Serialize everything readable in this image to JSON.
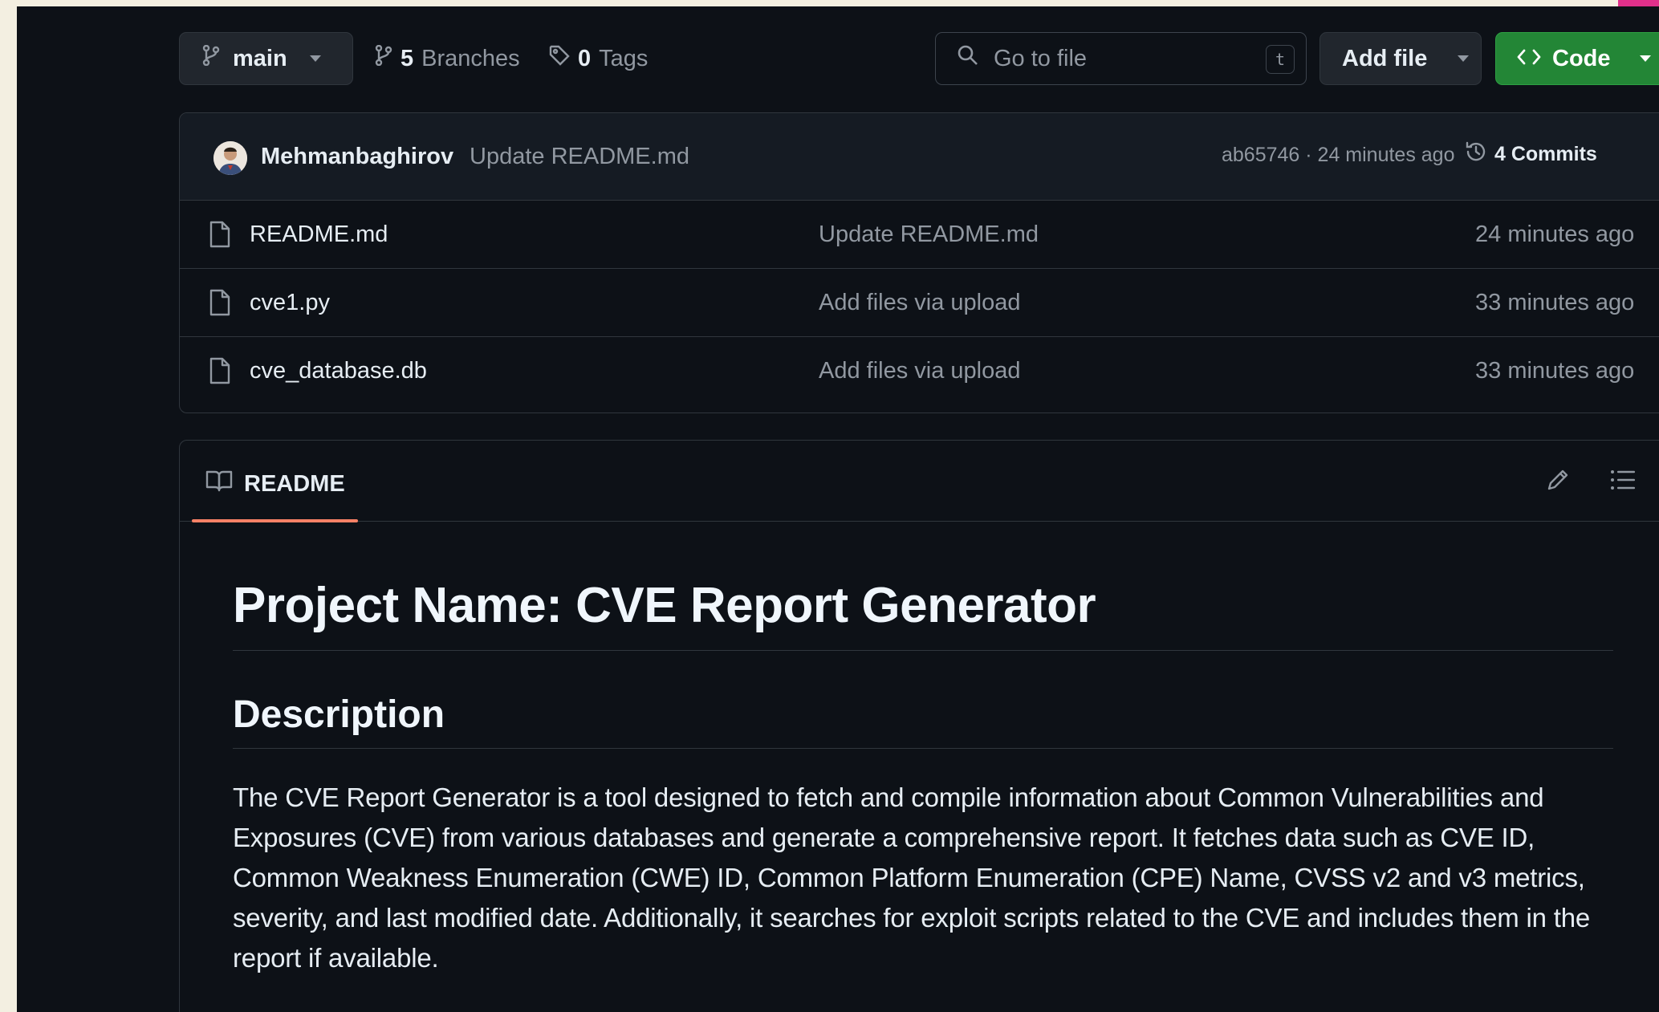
{
  "colors": {
    "page_background": "#0d1117",
    "accent_corner": "#e0308a",
    "code_button": "#238636",
    "tab_underline": "#f78166"
  },
  "toolbar": {
    "branch": "main",
    "branches_count": "5",
    "branches_label": "Branches",
    "tags_count": "0",
    "tags_label": "Tags",
    "search_placeholder": "Go to file",
    "search_shortcut": "t",
    "add_file_label": "Add file",
    "code_label": "Code"
  },
  "latest_commit": {
    "author": "Mehmanbaghirov",
    "message": "Update README.md",
    "hash_and_time": "ab65746 · 24 minutes ago",
    "commits_label": "4 Commits"
  },
  "files": [
    {
      "name": "README.md",
      "commit_message": "Update README.md",
      "time": "24 minutes ago"
    },
    {
      "name": "cve1.py",
      "commit_message": "Add files via upload",
      "time": "33 minutes ago"
    },
    {
      "name": "cve_database.db",
      "commit_message": "Add files via upload",
      "time": "33 minutes ago"
    }
  ],
  "readme": {
    "tab_label": "README",
    "title": "Project Name: CVE Report Generator",
    "section_heading": "Description",
    "description": "The CVE Report Generator is a tool designed to fetch and compile information about Common Vulnerabilities and Exposures (CVE) from various databases and generate a comprehensive report. It fetches data such as CVE ID, Common Weakness Enumeration (CWE) ID, Common Platform Enumeration (CPE) Name, CVSS v2 and v3 metrics, severity, and last modified date. Additionally, it searches for exploit scripts related to the CVE and includes them in the report if available."
  }
}
